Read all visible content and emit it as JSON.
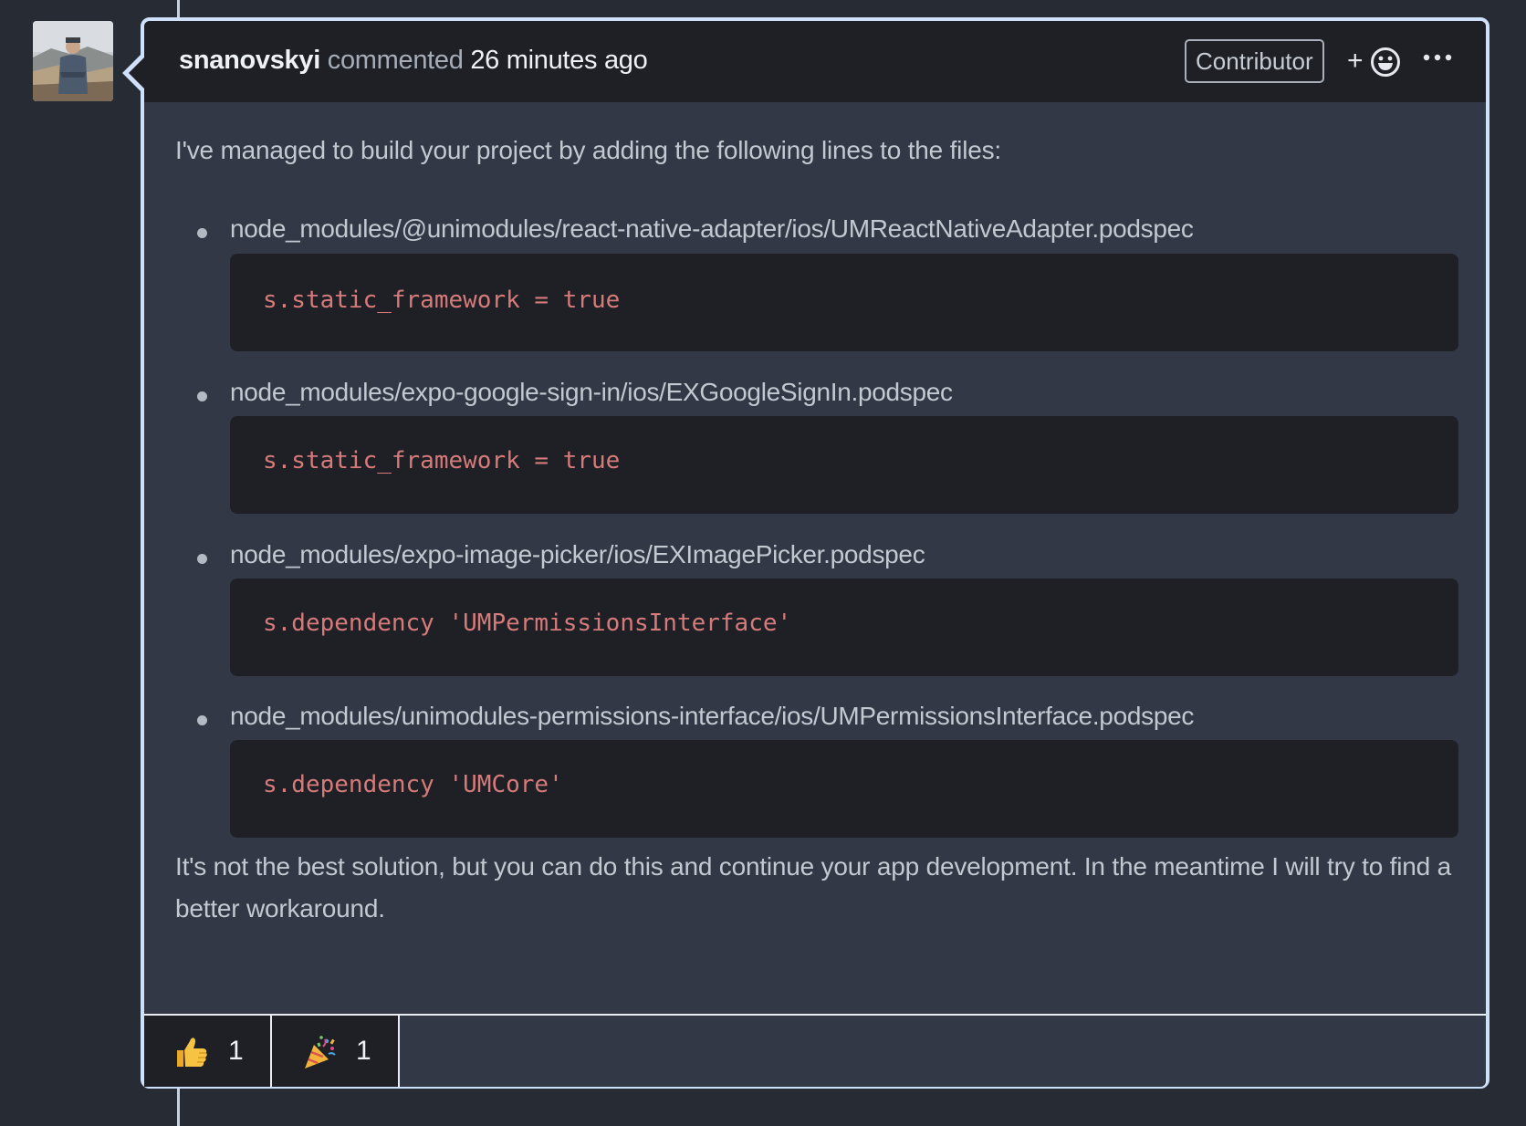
{
  "comment": {
    "author": "snanovskyi",
    "verb": "commented",
    "timestamp": "26 minutes ago",
    "badge": "Contributor",
    "add_reaction_label": "+",
    "intro": "I've managed to build your project by adding the following lines to the files:",
    "items": [
      {
        "path": "node_modules/@unimodules/react-native-adapter/ios/UMReactNativeAdapter.podspec",
        "code": "s.static_framework = true"
      },
      {
        "path": "node_modules/expo-google-sign-in/ios/EXGoogleSignIn.podspec",
        "code": "s.static_framework = true"
      },
      {
        "path": "node_modules/expo-image-picker/ios/EXImagePicker.podspec",
        "code": "s.dependency 'UMPermissionsInterface'"
      },
      {
        "path": "node_modules/unimodules-permissions-interface/ios/UMPermissionsInterface.podspec",
        "code": "s.dependency 'UMCore'"
      }
    ],
    "outro": "It's not the best solution, but you can do this and continue your app development. In the meantime I will try to find a better workaround."
  },
  "reactions": [
    {
      "icon": "thumbs-up-icon",
      "count": "1"
    },
    {
      "icon": "party-popper-icon",
      "count": "1"
    }
  ],
  "colors": {
    "background": "#272b33",
    "comment_body": "#323845",
    "comment_header": "#1e2026",
    "code_text": "#d67a7a",
    "border": "#cfe0fb"
  }
}
